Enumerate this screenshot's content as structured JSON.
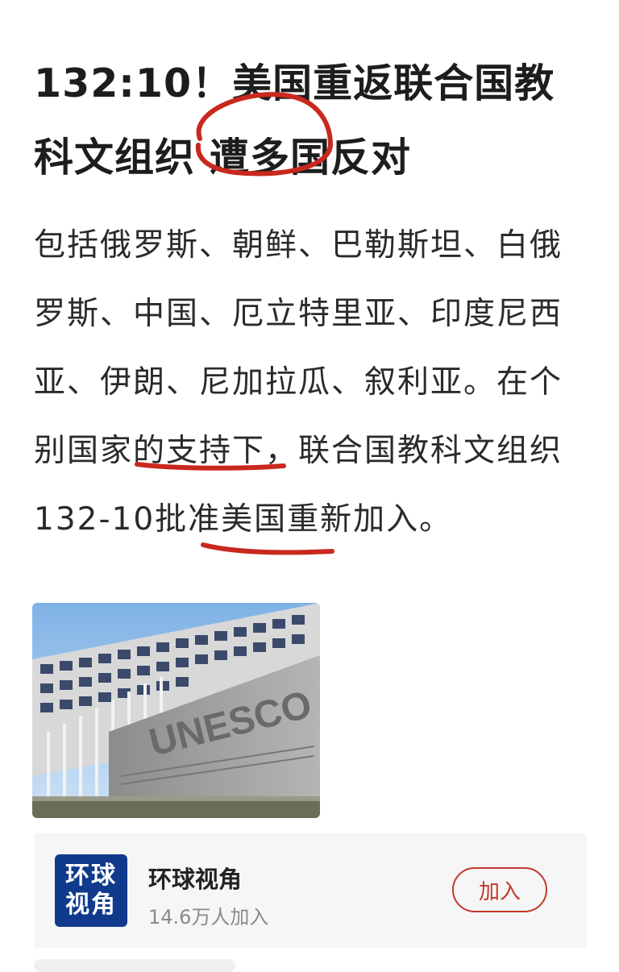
{
  "article": {
    "title": "132:10！美国重返联合国教科文组织 遭多国反对",
    "body": "包括俄罗斯、朝鲜、巴勒斯坦、白俄罗斯、中国、厄立特里亚、印度尼西亚、伊朗、尼加拉瓜、叙利亚。在个别国家的支持下，联合国教科文组织132-10批准美国重新加入。",
    "image_alt": "UNESCO headquarters building with UNESCO sign",
    "image_sign": "UNESCO"
  },
  "channel_card": {
    "logo_line1": "环球",
    "logo_line2": "视角",
    "name": "环球视角",
    "followers": "14.6万人加入",
    "join_label": "加入"
  },
  "colors": {
    "annotation_red": "#c9281e",
    "logo_blue": "#113a8c",
    "button_red": "#c0392b"
  }
}
